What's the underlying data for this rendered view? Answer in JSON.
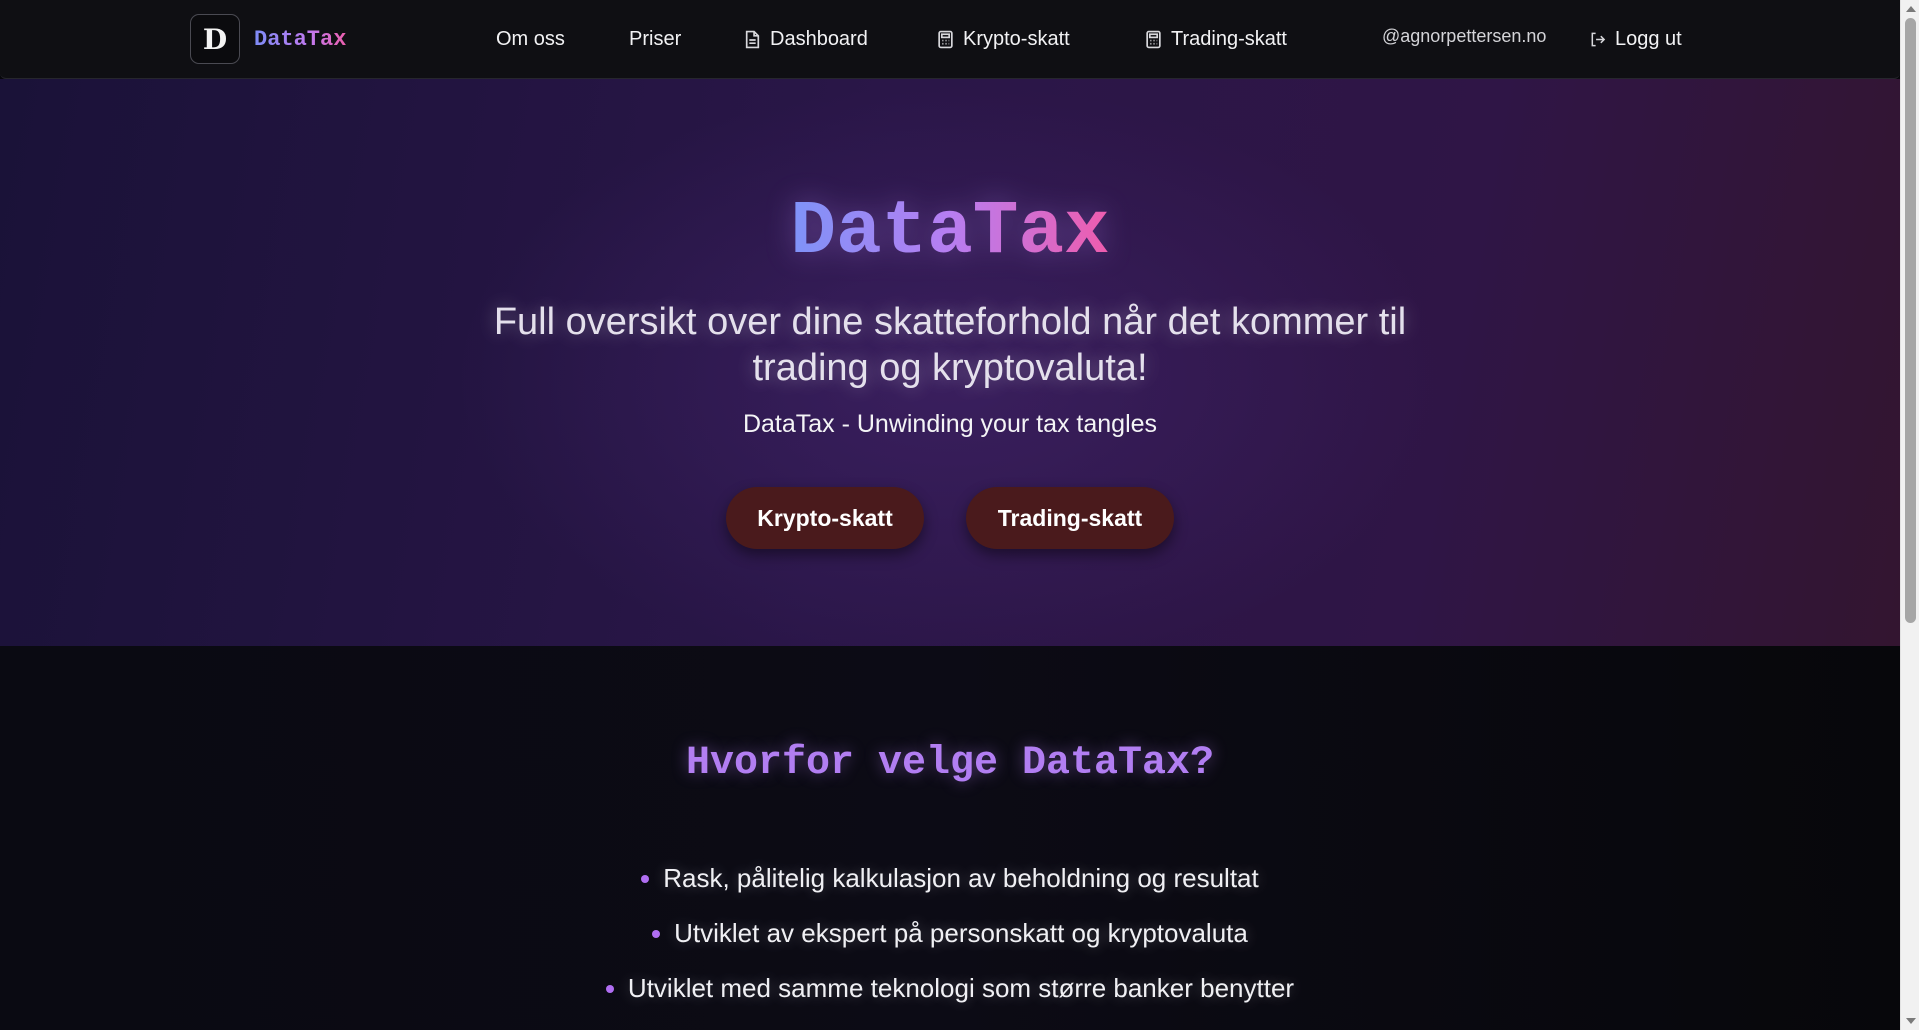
{
  "nav": {
    "logo_letter": "D",
    "brand": "DataTax",
    "links": {
      "om_oss": "Om oss",
      "priser": "Priser",
      "dashboard": "Dashboard",
      "krypto": "Krypto-skatt",
      "trading": "Trading-skatt"
    },
    "user": "@agnorpettersen.no",
    "logout": "Logg ut"
  },
  "hero": {
    "title": "DataTax",
    "subtitle": "Full oversikt over dine skatteforhold når det kommer til trading og kryptovaluta!",
    "tagline": "DataTax - Unwinding your tax tangles",
    "buttons": {
      "krypto": "Krypto-skatt",
      "trading": "Trading-skatt"
    }
  },
  "features": {
    "title": "Hvorfor velge DataTax?",
    "items": [
      "Rask, pålitelig kalkulasjon av beholdning og resultat",
      "Utviklet av ekspert på personskatt og kryptovaluta",
      "Utviklet med samme teknologi som større banker benytter"
    ]
  },
  "colors": {
    "accent_purple": "#b27ef2",
    "gradient_start": "#7e93f8",
    "gradient_end": "#ef5cad",
    "button_bg": "#4a1a1c",
    "nav_bg": "#0f0f13"
  },
  "icons": {
    "dashboard": "document-icon",
    "krypto": "calculator-icon",
    "trading": "calculator-icon",
    "logout": "logout-icon"
  }
}
